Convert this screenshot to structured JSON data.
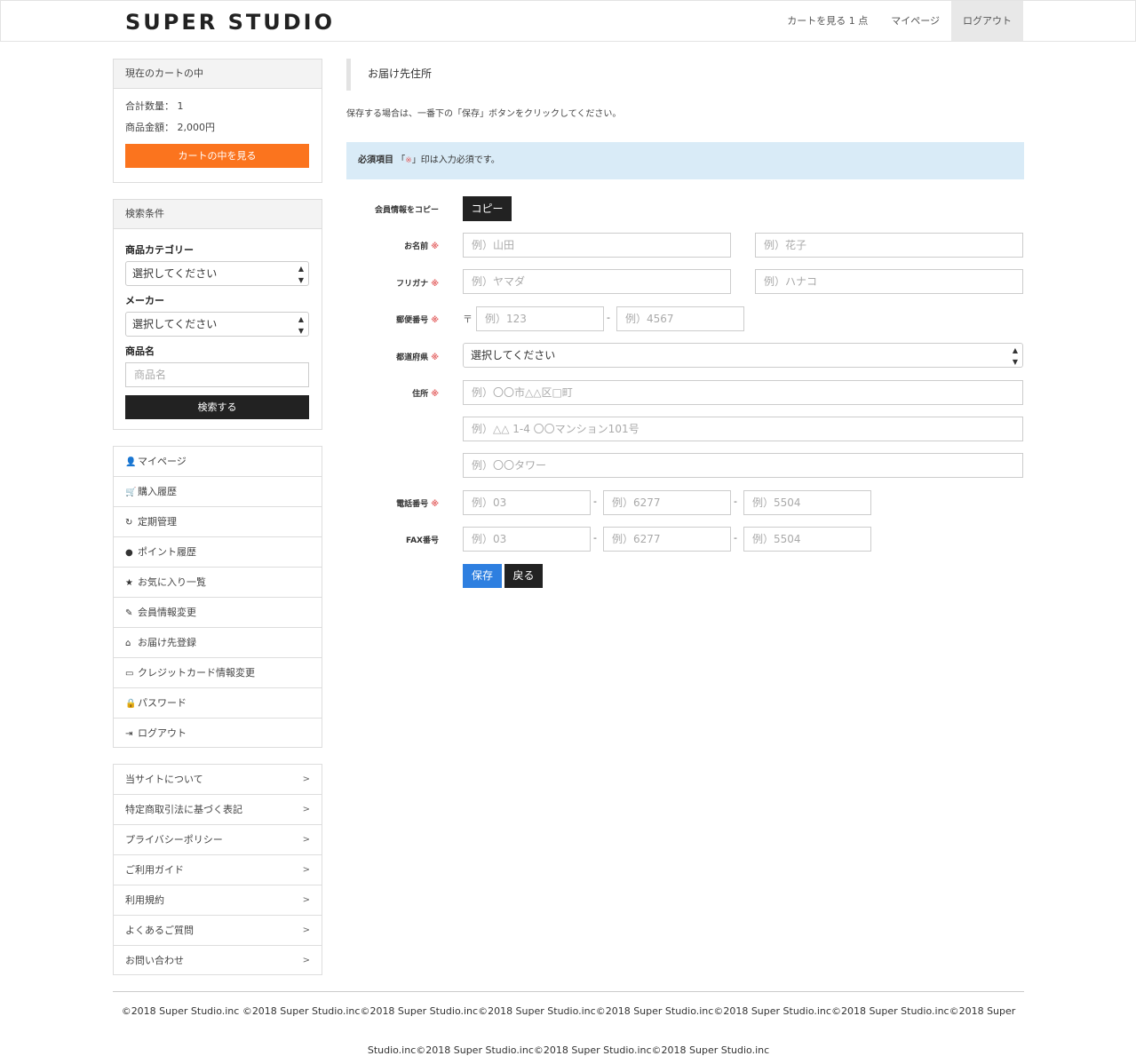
{
  "header": {
    "logo": "SUPER STUDIO",
    "nav": [
      "カートを見る 1 点",
      "マイページ",
      "ログアウト"
    ]
  },
  "cart": {
    "title": "現在のカートの中",
    "quantity": "合計数量： 1",
    "amount": "商品金額： 2,000円",
    "button": "カートの中を見る"
  },
  "search": {
    "title": "検索条件",
    "category_label": "商品カテゴリー",
    "category_value": "選択してください",
    "maker_label": "メーカー",
    "maker_value": "選択してください",
    "name_label": "商品名",
    "name_placeholder": "商品名",
    "button": "検索する"
  },
  "account_menu": [
    {
      "icon": "user-icon",
      "label": "マイページ"
    },
    {
      "icon": "cart-icon",
      "label": "購入履歴"
    },
    {
      "icon": "refresh-icon",
      "label": "定期管理"
    },
    {
      "icon": "piggy-bank-icon",
      "label": "ポイント履歴"
    },
    {
      "icon": "star-icon",
      "label": "お気に入り一覧"
    },
    {
      "icon": "pencil-icon",
      "label": "会員情報変更"
    },
    {
      "icon": "home-icon",
      "label": "お届け先登録"
    },
    {
      "icon": "credit-card-icon",
      "label": "クレジットカード情報変更"
    },
    {
      "icon": "lock-icon",
      "label": "パスワード"
    },
    {
      "icon": "logout-icon",
      "label": "ログアウト"
    }
  ],
  "info_menu": [
    {
      "label": "当サイトについて",
      "arrow": ">"
    },
    {
      "label": "特定商取引法に基づく表記",
      "arrow": ">"
    },
    {
      "label": "プライバシーポリシー",
      "arrow": ">"
    },
    {
      "label": "ご利用ガイド",
      "arrow": ">"
    },
    {
      "label": "利用規約",
      "arrow": ">"
    },
    {
      "label": "よくあるご質問",
      "arrow": ">"
    },
    {
      "label": "お問い合わせ",
      "arrow": ">"
    }
  ],
  "main": {
    "title": "お届け先住所",
    "intro": "保存する場合は、一番下の「保存」ボタンをクリックしてください。",
    "notice_bold": "必須項目",
    "notice_open": "「",
    "notice_mark": "※",
    "notice_rest": "」印は入力必須です。"
  },
  "form": {
    "required_mark": "※",
    "copy_label": "会員情報をコピー",
    "copy_button": "コピー",
    "name_label": "お名前",
    "name_last_ph": "例）山田",
    "name_first_ph": "例）花子",
    "kana_label": "フリガナ",
    "kana_last_ph": "例）ヤマダ",
    "kana_first_ph": "例）ハナコ",
    "zip_label": "郵便番号",
    "zip_mark": "〒",
    "zip1_ph": "例）123",
    "zip2_ph": "例）4567",
    "pref_label": "都道府県",
    "pref_value": "選択してください",
    "addr_label": "住所",
    "addr1_ph": "例）〇〇市△△区□町",
    "addr2_ph": "例）△△ 1-4 〇〇マンション101号",
    "addr3_ph": "例）〇〇タワー",
    "tel_label": "電話番号",
    "tel1_ph": "例）03",
    "tel2_ph": "例）6277",
    "tel3_ph": "例）5504",
    "fax_label": "FAX番号",
    "fax1_ph": "例）03",
    "fax2_ph": "例）6277",
    "fax3_ph": "例）5504",
    "dash": "-",
    "save": "保存",
    "back": "戻る"
  },
  "footer": {
    "line1": "©2018 Super Studio.inc ©2018 Super Studio.inc©2018 Super Studio.inc©2018 Super Studio.inc©2018 Super Studio.inc©2018 Super Studio.inc©2018 Super Studio.inc©2018 Super",
    "line2": "Studio.inc©2018 Super Studio.inc©2018 Super Studio.inc©2018 Super Studio.inc"
  },
  "colors": {
    "accent_orange": "#fb741e",
    "save_blue": "#2e7fe0",
    "notice_bg": "#d9ebf7",
    "required_red": "#e36060"
  }
}
